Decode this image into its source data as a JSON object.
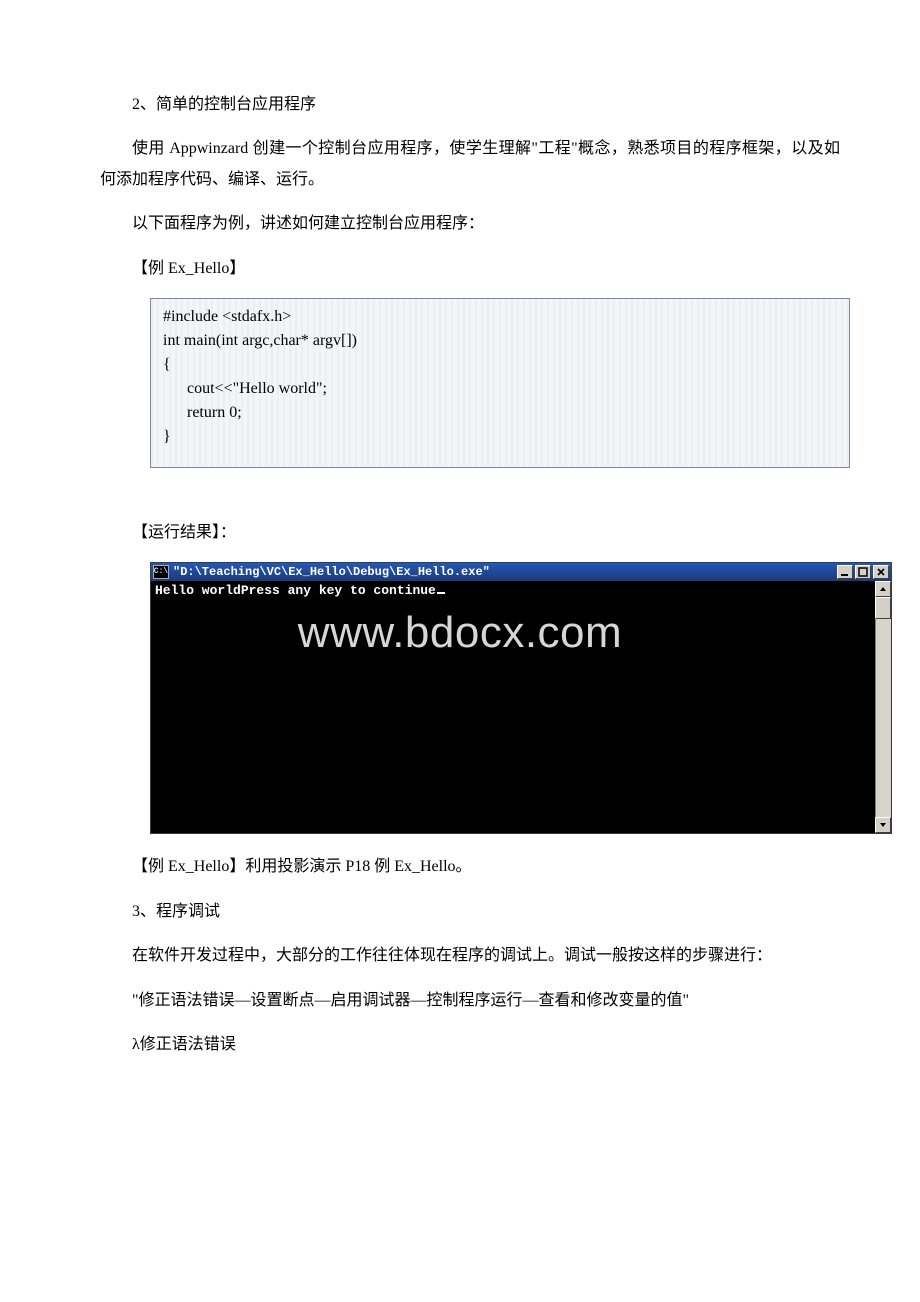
{
  "doc": {
    "heading1": "2、简单的控制台应用程序",
    "para1": "使用 Appwinzard 创建一个控制台应用程序，使学生理解\"工程\"概念，熟悉项目的程序框架，以及如何添加程序代码、编译、运行。",
    "para2": "以下面程序为例，讲述如何建立控制台应用程序：",
    "example_label": "【例 Ex_Hello】",
    "code": "#include <stdafx.h>\nint main(int argc,char* argv[])\n{\n      cout<<\"Hello world\";\n      return 0;\n}",
    "watermark": "www.bdocx.com",
    "result_label": "【运行结果】：",
    "console": {
      "icon_text": "C:\\",
      "title": "\"D:\\Teaching\\VC\\Ex_Hello\\Debug\\Ex_Hello.exe\"",
      "output": "Hello worldPress any key to continue"
    },
    "para3": "【例 Ex_Hello】利用投影演示 P18 例 Ex_Hello。",
    "heading2": "3、程序调试",
    "para4": "在软件开发过程中，大部分的工作往往体现在程序的调试上。调试一般按这样的步骤进行：",
    "para5": "\"修正语法错误—设置断点—启用调试器—控制程序运行—查看和修改变量的值\"",
    "para6": "λ修正语法错误"
  }
}
